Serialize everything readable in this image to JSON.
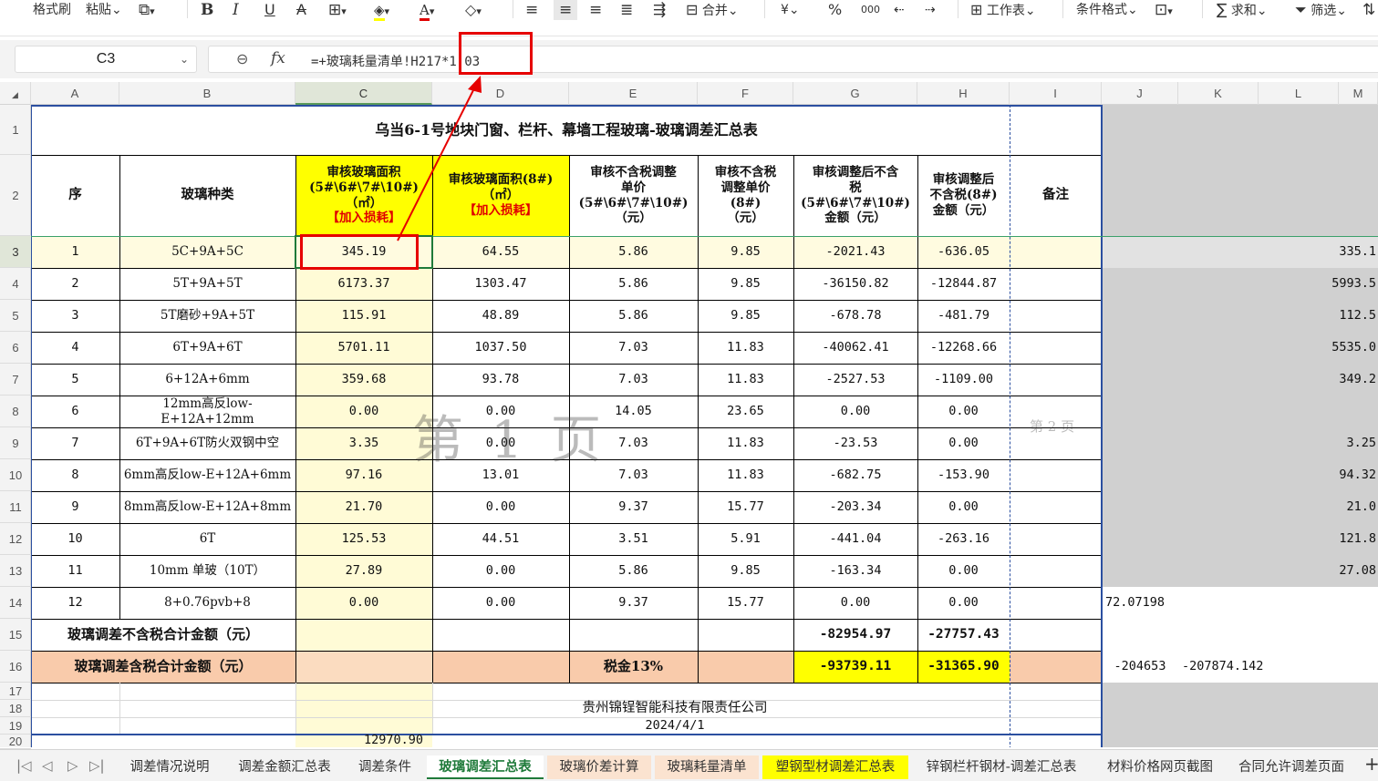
{
  "toolbar": {
    "format_painter": "格式刷",
    "paste": "粘贴",
    "merge": "合并",
    "worksheet": "工作表",
    "conditional_format": "条件格式",
    "sum": "求和",
    "filter": "筛选",
    "currency_symbol": "¥",
    "percent_symbol": "%",
    "thousands_symbol": "000",
    "dropdown_arrow": "⌄"
  },
  "formula_bar": {
    "cell_ref": "C3",
    "fx": "fx",
    "formula": "=+玻璃耗量清单!H217*1.03"
  },
  "columns": [
    "A",
    "B",
    "C",
    "D",
    "E",
    "F",
    "G",
    "H",
    "I",
    "J",
    "K",
    "L",
    "M"
  ],
  "rows": [
    "1",
    "2",
    "3",
    "4",
    "5",
    "6",
    "7",
    "8",
    "9",
    "10",
    "11",
    "12",
    "13",
    "14",
    "15",
    "16",
    "17",
    "18",
    "19",
    "20"
  ],
  "sheet": {
    "title": "乌当6-1号地块门窗、栏杆、幕墙工程玻璃-玻璃调差汇总表",
    "headers": {
      "a": "序",
      "b": "玻璃种类",
      "c": "审核玻璃面积\n(5#\\6#\\7#\\10#)\n（㎡）",
      "c_red": "【加入损耗】",
      "d": "审核玻璃面积(8#)\n（㎡）",
      "d_red": "【加入损耗】",
      "e": "审核不含税调整\n单价\n(5#\\6#\\7#\\10#)\n（元）",
      "f": "审核不含税\n调整单价\n(8#)\n（元）",
      "g": "审核调整后不含\n税\n(5#\\6#\\7#\\10#)\n金额（元）",
      "h": "审核调整后\n不含税(8#)\n金额（元）",
      "i": "备注"
    },
    "data_rows": [
      {
        "no": "1",
        "type": "5C+9A+5C",
        "c": "345.19",
        "d": "64.55",
        "e": "5.86",
        "f": "9.85",
        "g": "-2021.43",
        "h": "-636.05",
        "m": "335.1"
      },
      {
        "no": "2",
        "type": "5T+9A+5T",
        "c": "6173.37",
        "d": "1303.47",
        "e": "5.86",
        "f": "9.85",
        "g": "-36150.82",
        "h": "-12844.87",
        "m": "5993.5"
      },
      {
        "no": "3",
        "type": "5T磨砂+9A+5T",
        "c": "115.91",
        "d": "48.89",
        "e": "5.86",
        "f": "9.85",
        "g": "-678.78",
        "h": "-481.79",
        "m": "112.5"
      },
      {
        "no": "4",
        "type": "6T+9A+6T",
        "c": "5701.11",
        "d": "1037.50",
        "e": "7.03",
        "f": "11.83",
        "g": "-40062.41",
        "h": "-12268.66",
        "m": "5535.0"
      },
      {
        "no": "5",
        "type": "6+12A+6mm",
        "c": "359.68",
        "d": "93.78",
        "e": "7.03",
        "f": "11.83",
        "g": "-2527.53",
        "h": "-1109.00",
        "m": "349.2"
      },
      {
        "no": "6",
        "type": "12mm高反low-E+12A+12mm",
        "c": "0.00",
        "d": "0.00",
        "e": "14.05",
        "f": "23.65",
        "g": "0.00",
        "h": "0.00",
        "m": ""
      },
      {
        "no": "7",
        "type": "6T+9A+6T防火双钢中空",
        "c": "3.35",
        "d": "0.00",
        "e": "7.03",
        "f": "11.83",
        "g": "-23.53",
        "h": "0.00",
        "m": "3.25"
      },
      {
        "no": "8",
        "type": "6mm高反low-E+12A+6mm",
        "c": "97.16",
        "d": "13.01",
        "e": "7.03",
        "f": "11.83",
        "g": "-682.75",
        "h": "-153.90",
        "m": "94.32"
      },
      {
        "no": "9",
        "type": "8mm高反low-E+12A+8mm",
        "c": "21.70",
        "d": "0.00",
        "e": "9.37",
        "f": "15.77",
        "g": "-203.34",
        "h": "0.00",
        "m": "21.0"
      },
      {
        "no": "10",
        "type": "6T",
        "c": "125.53",
        "d": "44.51",
        "e": "3.51",
        "f": "5.91",
        "g": "-441.04",
        "h": "-263.16",
        "m": "121.8"
      },
      {
        "no": "11",
        "type": "10mm 单玻（10T）",
        "c": "27.89",
        "d": "0.00",
        "e": "5.86",
        "f": "9.85",
        "g": "-163.34",
        "h": "0.00",
        "m": "27.08"
      },
      {
        "no": "12",
        "type": "8+0.76pvb+8",
        "c": "0.00",
        "d": "0.00",
        "e": "9.37",
        "f": "15.77",
        "g": "0.00",
        "h": "0.00",
        "m": ""
      }
    ],
    "row14_j": "72.07198",
    "total_ex_tax_label": "玻璃调差不含税合计金额（元）",
    "total_ex_tax_g": "-82954.97",
    "total_ex_tax_h": "-27757.43",
    "total_inc_tax_label": "玻璃调差含税合计金额（元）",
    "tax_label": "税金13%",
    "total_inc_tax_g": "-93739.11",
    "total_inc_tax_h": "-31365.90",
    "row16_j": "-204653",
    "row16_k": "-207874.142",
    "company": "贵州锦锃智能科技有限责任公司",
    "date": "2024/4/1",
    "row20_c": "12970.90",
    "watermark_page1": "第 1 页",
    "watermark_page2": "第 2 页"
  },
  "tabs": [
    "调差情况说明",
    "调差金额汇总表",
    "调差条件",
    "玻璃调差汇总表",
    "玻璃价差计算",
    "玻璃耗量清单",
    "塑钢型材调差汇总表",
    "锌钢栏杆钢材-调差汇总表",
    "材料价格网页截图",
    "合同允许调差页面"
  ],
  "active_tab": "玻璃调差汇总表",
  "colors": {
    "yellow_header": "#ffff00",
    "light_yellow": "#fffbd6",
    "salmon": "#f9cbab",
    "red_box": "#e60000",
    "gray_area": "#d0d0d0",
    "selected_tab": "#1f7a3a",
    "yellow_tab": "#ffff00",
    "orange_tab": "#fbe3d0"
  }
}
